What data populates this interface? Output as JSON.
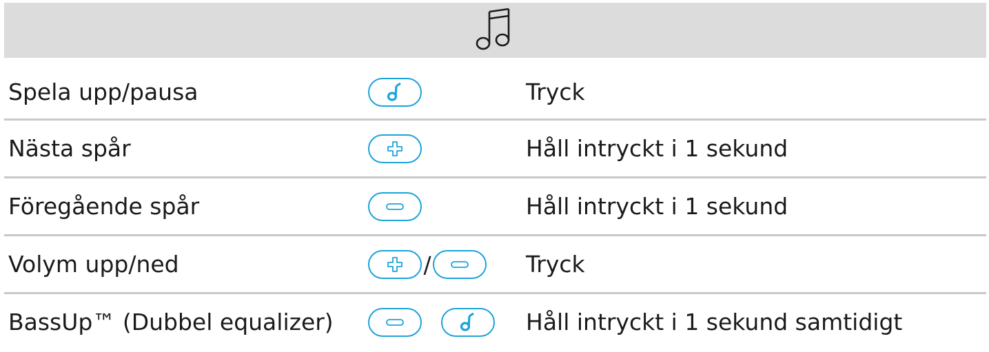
{
  "header": {
    "icon": "music-notes-icon"
  },
  "colors": {
    "header_bg": "#dcdcdc",
    "accent": "#1aa3d9",
    "separator": "#c8c8c8",
    "text": "#1a1a1a"
  },
  "rows": [
    {
      "label": "Spela upp/pausa",
      "action": "Tryck",
      "buttons": [
        "music-note-button"
      ]
    },
    {
      "label": "Nästa spår",
      "action": "Håll intryckt i 1 sekund",
      "buttons": [
        "plus-button"
      ]
    },
    {
      "label": "Föregående spår",
      "action": "Håll intryckt i 1 sekund",
      "buttons": [
        "minus-button"
      ]
    },
    {
      "label": "Volym upp/ned",
      "action": "Tryck",
      "buttons": [
        "plus-button",
        "minus-button"
      ],
      "separator": "/"
    },
    {
      "label": "BassUp™ (Dubbel equalizer)",
      "action": "Håll intryckt i 1 sekund samtidigt",
      "buttons": [
        "minus-button",
        "music-note-button"
      ]
    }
  ]
}
